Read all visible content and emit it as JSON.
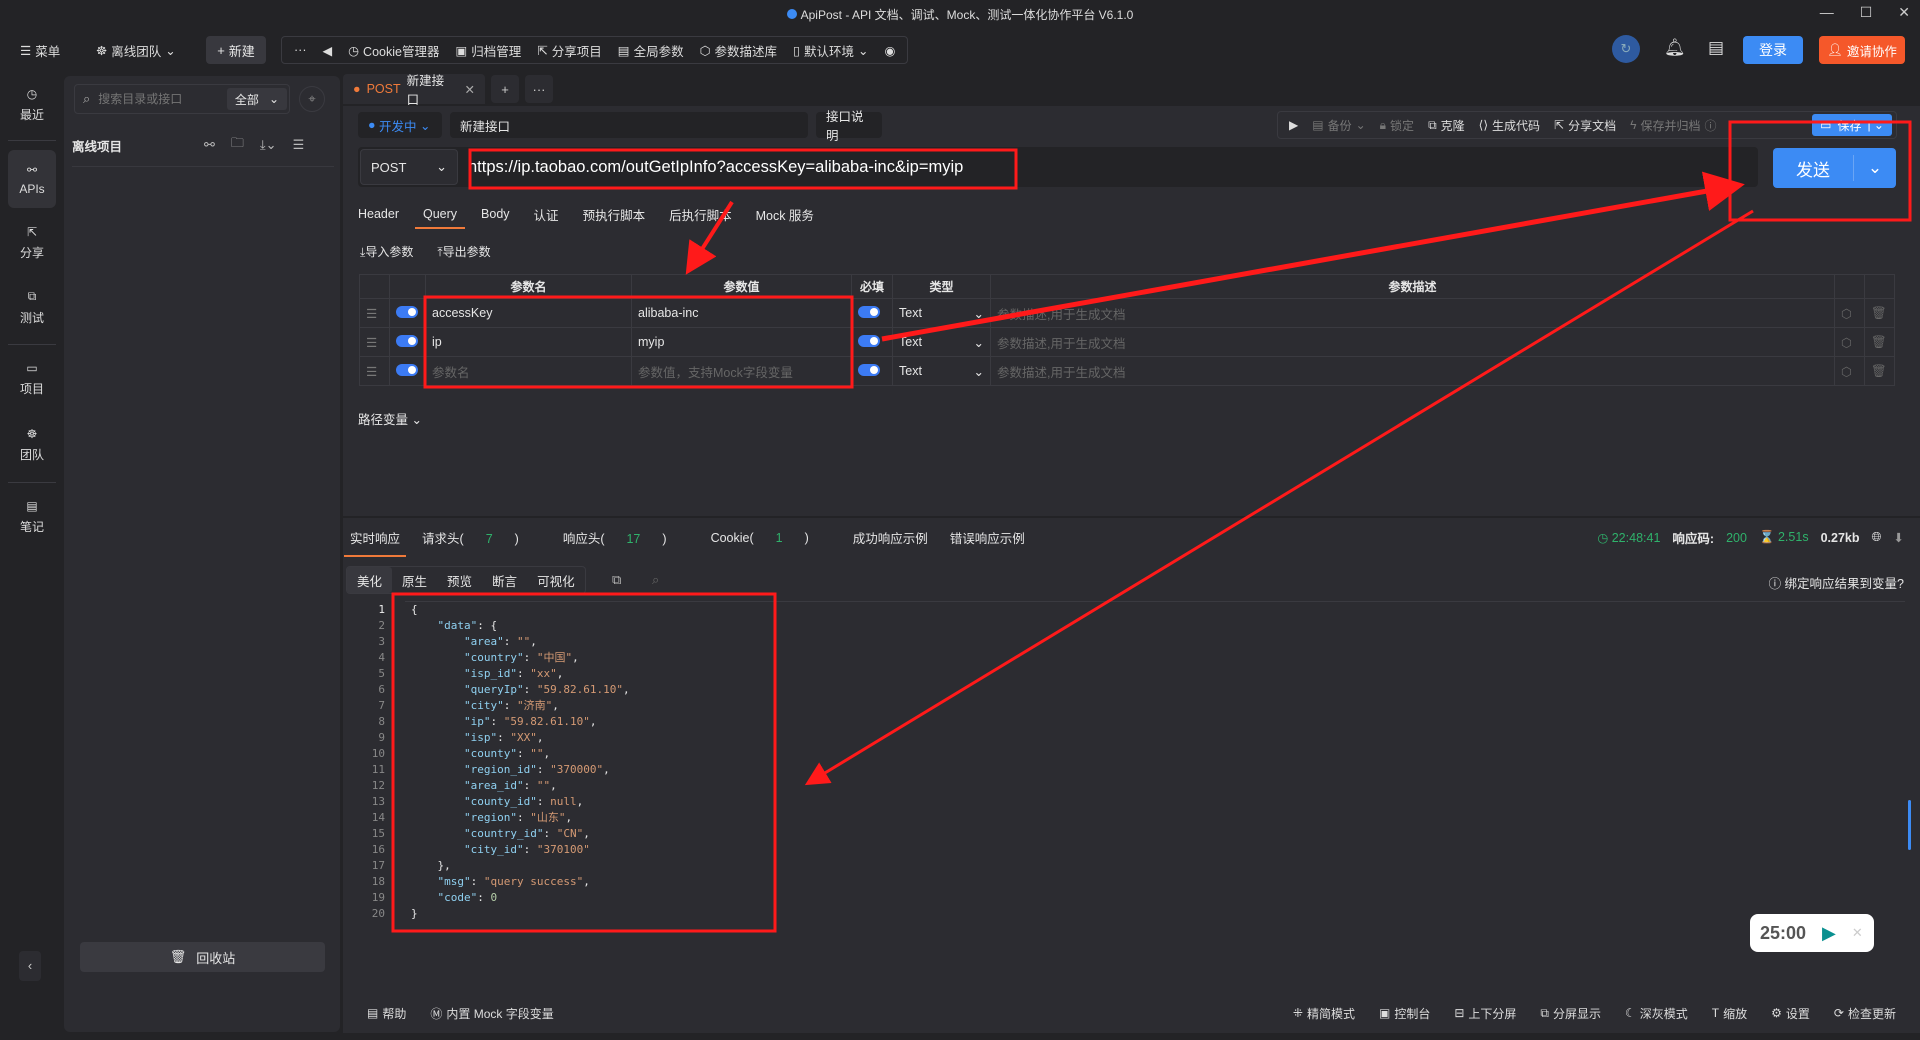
{
  "window": {
    "title": "ApiPost - API 文档、调试、Mock、测试一体化协作平台 V6.1.0",
    "min": "—",
    "max": "☐",
    "close": "✕"
  },
  "topbar": {
    "menu": "菜单",
    "team": "离线团队",
    "new": "新建",
    "more": "···",
    "items": [
      "Cookie管理器",
      "归档管理",
      "分享项目",
      "全局参数",
      "参数描述库",
      "默认环境"
    ],
    "login": "登录",
    "invite": "邀请协作"
  },
  "leftnav": [
    {
      "label": "最近",
      "icon": "clock-icon"
    },
    {
      "label": "APIs",
      "icon": "api-icon"
    },
    {
      "label": "分享",
      "icon": "share-icon"
    },
    {
      "label": "测试",
      "icon": "test-icon"
    },
    {
      "label": "项目",
      "icon": "project-icon"
    },
    {
      "label": "团队",
      "icon": "team-icon"
    },
    {
      "label": "笔记",
      "icon": "note-icon"
    }
  ],
  "sidebar": {
    "search_placeholder": "搜索目录或接口",
    "filter": "全部",
    "project": "离线项目",
    "recycle": "回收站"
  },
  "tab": {
    "method": "POST",
    "name": "新建接口"
  },
  "request": {
    "status": "开发中",
    "name": "新建接口",
    "doc": "接口说明",
    "tools": [
      "备份",
      "锁定",
      "克隆",
      "生成代码",
      "分享文档",
      "保存并归档"
    ],
    "save": "保存",
    "method": "POST",
    "url": "https://ip.taobao.com/outGetIpInfo?accessKey=alibaba-inc&ip=myip",
    "send": "发送"
  },
  "reqtabs": [
    "Header",
    "Query",
    "Body",
    "认证",
    "预执行脚本",
    "后执行脚本",
    "Mock 服务"
  ],
  "params": {
    "import": "导入参数",
    "export": "导出参数",
    "headers": [
      "参数名",
      "参数值",
      "必填",
      "类型",
      "参数描述"
    ],
    "rows": [
      {
        "name": "accessKey",
        "value": "alibaba-inc",
        "type": "Text",
        "desc": "参数描述,用于生成文档"
      },
      {
        "name": "ip",
        "value": "myip",
        "type": "Text",
        "desc": "参数描述,用于生成文档"
      }
    ],
    "empty": {
      "name": "参数名",
      "value": "参数值，支持Mock字段变量",
      "type": "Text",
      "desc": "参数描述,用于生成文档"
    },
    "path_vars": "路径变量"
  },
  "response": {
    "tabs": [
      "实时响应",
      "请求头(",
      "7",
      ")",
      "响应头(",
      "17",
      ")",
      "Cookie(",
      "1",
      ")",
      "成功响应示例",
      "错误响应示例"
    ],
    "time": "22:48:41",
    "code_label": "响应码:",
    "code": "200",
    "duration": "2.51s",
    "size": "0.27kb",
    "subtabs": [
      "美化",
      "原生",
      "预览",
      "断言",
      "可视化"
    ],
    "bind": "绑定响应结果到变量?"
  },
  "code_lines": [
    [
      [
        "p",
        "{"
      ]
    ],
    [
      [
        "p",
        "    "
      ],
      [
        "k",
        "\"data\""
      ],
      [
        "p",
        ": {"
      ]
    ],
    [
      [
        "p",
        "        "
      ],
      [
        "k",
        "\"area\""
      ],
      [
        "p",
        ": "
      ],
      [
        "s",
        "\"\""
      ],
      [
        "p",
        ","
      ]
    ],
    [
      [
        "p",
        "        "
      ],
      [
        "k",
        "\"country\""
      ],
      [
        "p",
        ": "
      ],
      [
        "s",
        "\"中国\""
      ],
      [
        "p",
        ","
      ]
    ],
    [
      [
        "p",
        "        "
      ],
      [
        "k",
        "\"isp_id\""
      ],
      [
        "p",
        ": "
      ],
      [
        "s",
        "\"xx\""
      ],
      [
        "p",
        ","
      ]
    ],
    [
      [
        "p",
        "        "
      ],
      [
        "k",
        "\"queryIp\""
      ],
      [
        "p",
        ": "
      ],
      [
        "s",
        "\"59.82.61.10\""
      ],
      [
        "p",
        ","
      ]
    ],
    [
      [
        "p",
        "        "
      ],
      [
        "k",
        "\"city\""
      ],
      [
        "p",
        ": "
      ],
      [
        "s",
        "\"济南\""
      ],
      [
        "p",
        ","
      ]
    ],
    [
      [
        "p",
        "        "
      ],
      [
        "k",
        "\"ip\""
      ],
      [
        "p",
        ": "
      ],
      [
        "s",
        "\"59.82.61.10\""
      ],
      [
        "p",
        ","
      ]
    ],
    [
      [
        "p",
        "        "
      ],
      [
        "k",
        "\"isp\""
      ],
      [
        "p",
        ": "
      ],
      [
        "s",
        "\"XX\""
      ],
      [
        "p",
        ","
      ]
    ],
    [
      [
        "p",
        "        "
      ],
      [
        "k",
        "\"county\""
      ],
      [
        "p",
        ": "
      ],
      [
        "s",
        "\"\""
      ],
      [
        "p",
        ","
      ]
    ],
    [
      [
        "p",
        "        "
      ],
      [
        "k",
        "\"region_id\""
      ],
      [
        "p",
        ": "
      ],
      [
        "s",
        "\"370000\""
      ],
      [
        "p",
        ","
      ]
    ],
    [
      [
        "p",
        "        "
      ],
      [
        "k",
        "\"area_id\""
      ],
      [
        "p",
        ": "
      ],
      [
        "s",
        "\"\""
      ],
      [
        "p",
        ","
      ]
    ],
    [
      [
        "p",
        "        "
      ],
      [
        "k",
        "\"county_id\""
      ],
      [
        "p",
        ": "
      ],
      [
        "s",
        "null"
      ],
      [
        "p",
        ","
      ]
    ],
    [
      [
        "p",
        "        "
      ],
      [
        "k",
        "\"region\""
      ],
      [
        "p",
        ": "
      ],
      [
        "s",
        "\"山东\""
      ],
      [
        "p",
        ","
      ]
    ],
    [
      [
        "p",
        "        "
      ],
      [
        "k",
        "\"country_id\""
      ],
      [
        "p",
        ": "
      ],
      [
        "s",
        "\"CN\""
      ],
      [
        "p",
        ","
      ]
    ],
    [
      [
        "p",
        "        "
      ],
      [
        "k",
        "\"city_id\""
      ],
      [
        "p",
        ": "
      ],
      [
        "s",
        "\"370100\""
      ]
    ],
    [
      [
        "p",
        "    },"
      ]
    ],
    [
      [
        "p",
        "    "
      ],
      [
        "k",
        "\"msg\""
      ],
      [
        "p",
        ": "
      ],
      [
        "s",
        "\"query success\""
      ],
      [
        "p",
        ","
      ]
    ],
    [
      [
        "p",
        "    "
      ],
      [
        "k",
        "\"code\""
      ],
      [
        "p",
        ": "
      ],
      [
        "nu",
        "0"
      ]
    ],
    [
      [
        "p",
        "}"
      ]
    ]
  ],
  "bottombar": {
    "left": [
      "帮助",
      "内置 Mock 字段变量"
    ],
    "right": [
      "精简模式",
      "控制台",
      "上下分屏",
      "分屏显示",
      "深灰模式",
      "缩放",
      "设置",
      "检查更新"
    ]
  },
  "timer": {
    "value": "25:00"
  },
  "colors": {
    "accent": "#3c8bf4",
    "invite": "#f5582a",
    "annotation": "#ff1a1a",
    "success": "#2fb26b",
    "tab_underline": "#f07a3a"
  }
}
